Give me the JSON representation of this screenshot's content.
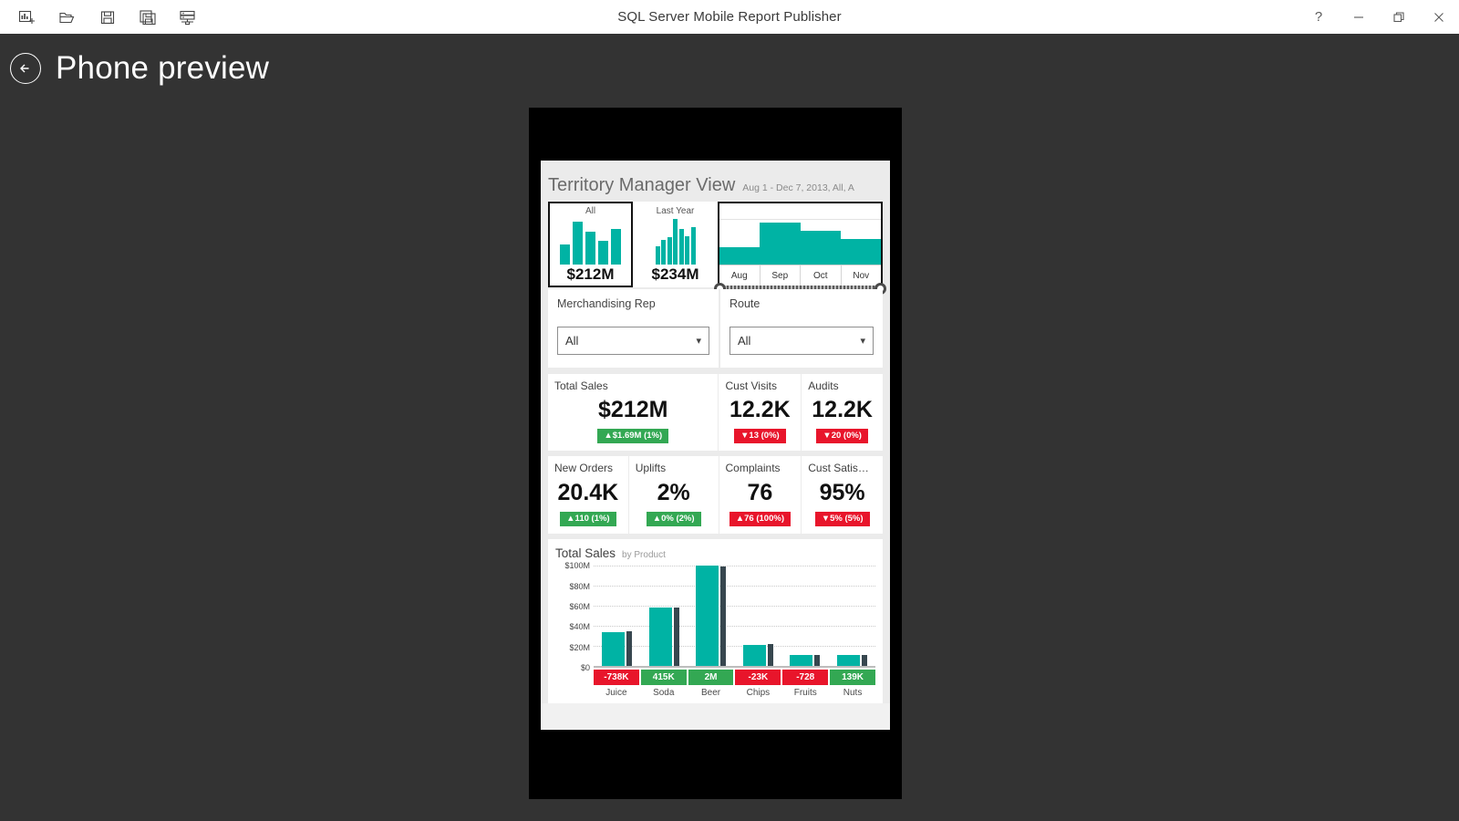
{
  "window": {
    "title": "SQL Server Mobile Report Publisher",
    "toolbar": [
      {
        "name": "new-report-icon",
        "tooltip": "New"
      },
      {
        "name": "open-folder-icon",
        "tooltip": "Open"
      },
      {
        "name": "save-icon",
        "tooltip": "Save"
      },
      {
        "name": "save-as-icon",
        "tooltip": "Save As"
      },
      {
        "name": "save-to-server-icon",
        "tooltip": "Save to Server"
      }
    ],
    "controls": [
      {
        "name": "help-button",
        "glyph": "?"
      },
      {
        "name": "minimize-button",
        "glyph": "—"
      },
      {
        "name": "restore-button",
        "glyph": "❐"
      },
      {
        "name": "close-button",
        "glyph": "✕"
      }
    ]
  },
  "preview": {
    "back_label": "Back",
    "title": "Phone preview"
  },
  "report": {
    "title": "Territory Manager View",
    "subtitle": "Aug 1 - Dec 7, 2013, All, A",
    "gauges": [
      {
        "label": "All",
        "value": "$212M",
        "selected": true,
        "bars": [
          45,
          95,
          72,
          52,
          78
        ]
      },
      {
        "label": "Last Year",
        "value": "$234M",
        "selected": false,
        "bars": [
          40,
          55,
          60,
          100,
          78,
          62,
          83
        ]
      }
    ],
    "time_selector": {
      "ticks": [
        "Aug",
        "Sep",
        "Oct",
        "Nov"
      ],
      "values": [
        28,
        68,
        55,
        42
      ],
      "handles": [
        "range-handle-left",
        "range-handle-right"
      ]
    },
    "selectors": [
      {
        "label": "Merchandising Rep",
        "value": "All"
      },
      {
        "label": "Route",
        "value": "All"
      }
    ],
    "kpis_row1": [
      {
        "title": "Total Sales",
        "value": "$212M",
        "delta": "▲$1.69M (1%)",
        "direction": "up"
      },
      {
        "title": "Cust Visits",
        "value": "12.2K",
        "delta": "▼13 (0%)",
        "direction": "down"
      },
      {
        "title": "Audits",
        "value": "12.2K",
        "delta": "▼20 (0%)",
        "direction": "down"
      }
    ],
    "kpis_row2": [
      {
        "title": "New Orders",
        "value": "20.4K",
        "delta": "▲110 (1%)",
        "direction": "up"
      },
      {
        "title": "Uplifts",
        "value": "2%",
        "delta": "▲0% (2%)",
        "direction": "up"
      },
      {
        "title": "Complaints",
        "value": "76",
        "delta": "▲76 (100%)",
        "direction": "down"
      },
      {
        "title": "Cust Satis…",
        "value": "95%",
        "delta": "▼5% (5%)",
        "direction": "down"
      }
    ]
  },
  "colors": {
    "teal": "#00b3a4",
    "dark_bar": "#37474f",
    "positive": "#33a853",
    "negative": "#e8152b",
    "page_bg": "#333333",
    "screen_bg": "#ebebeb"
  },
  "chart_data": {
    "type": "bar",
    "title": "Total Sales",
    "subtitle": "by Product",
    "xlabel": "",
    "ylabel": "",
    "ylim": [
      0,
      100
    ],
    "grid": true,
    "ytick_labels": [
      "$100M",
      "$80M",
      "$60M",
      "$40M",
      "$20M",
      "$0"
    ],
    "ytick_values": [
      100,
      80,
      60,
      40,
      20,
      0
    ],
    "categories": [
      "Juice",
      "Soda",
      "Beer",
      "Chips",
      "Fruits",
      "Nuts"
    ],
    "series": [
      {
        "name": "Total Sales",
        "values": [
          34,
          58,
          100,
          21,
          11,
          11
        ]
      },
      {
        "name": "Comparison",
        "values": [
          35,
          58,
          99,
          22,
          11,
          11
        ]
      }
    ],
    "data_labels": [
      {
        "text": "-738K",
        "direction": "down"
      },
      {
        "text": "415K",
        "direction": "up"
      },
      {
        "text": "2M",
        "direction": "up"
      },
      {
        "text": "-23K",
        "direction": "down"
      },
      {
        "text": "-728",
        "direction": "down"
      },
      {
        "text": "139K",
        "direction": "up"
      }
    ]
  }
}
